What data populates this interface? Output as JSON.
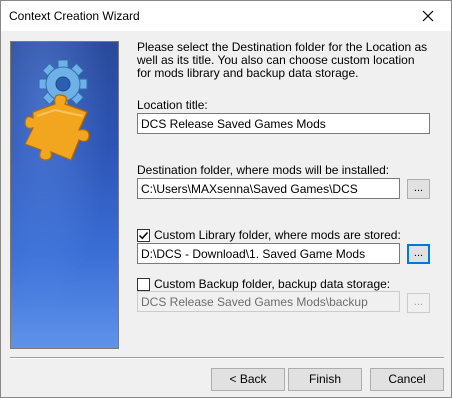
{
  "window": {
    "title": "Context Creation Wizard"
  },
  "intro": "Please select the Destination folder for the Location as well as its title. You also can choose custom location for mods library and backup data storage.",
  "location": {
    "label": "Location title:",
    "value": "DCS Release Saved Games Mods"
  },
  "destination": {
    "label": "Destination folder, where mods will be installed:",
    "value": "C:\\Users\\MAXsenna\\Saved Games\\DCS",
    "browse": "..."
  },
  "library": {
    "checked": true,
    "label": "Custom Library folder, where mods are stored:",
    "value": "D:\\DCS - Download\\1. Saved Game Mods",
    "browse": "..."
  },
  "backup": {
    "checked": false,
    "label": "Custom Backup folder, backup data storage:",
    "value": "DCS Release Saved Games Mods\\backup",
    "browse": "..."
  },
  "buttons": {
    "back": "< Back",
    "finish": "Finish",
    "cancel": "Cancel"
  },
  "colors": {
    "banner_top": "#2a4a9a",
    "banner_bottom": "#5f93ea",
    "gear": "#5aa0d8",
    "puzzle": "#f2a51f",
    "focus": "#0078d7"
  },
  "icons": {
    "close": "close-icon",
    "banner": "gear-puzzle-icon"
  }
}
